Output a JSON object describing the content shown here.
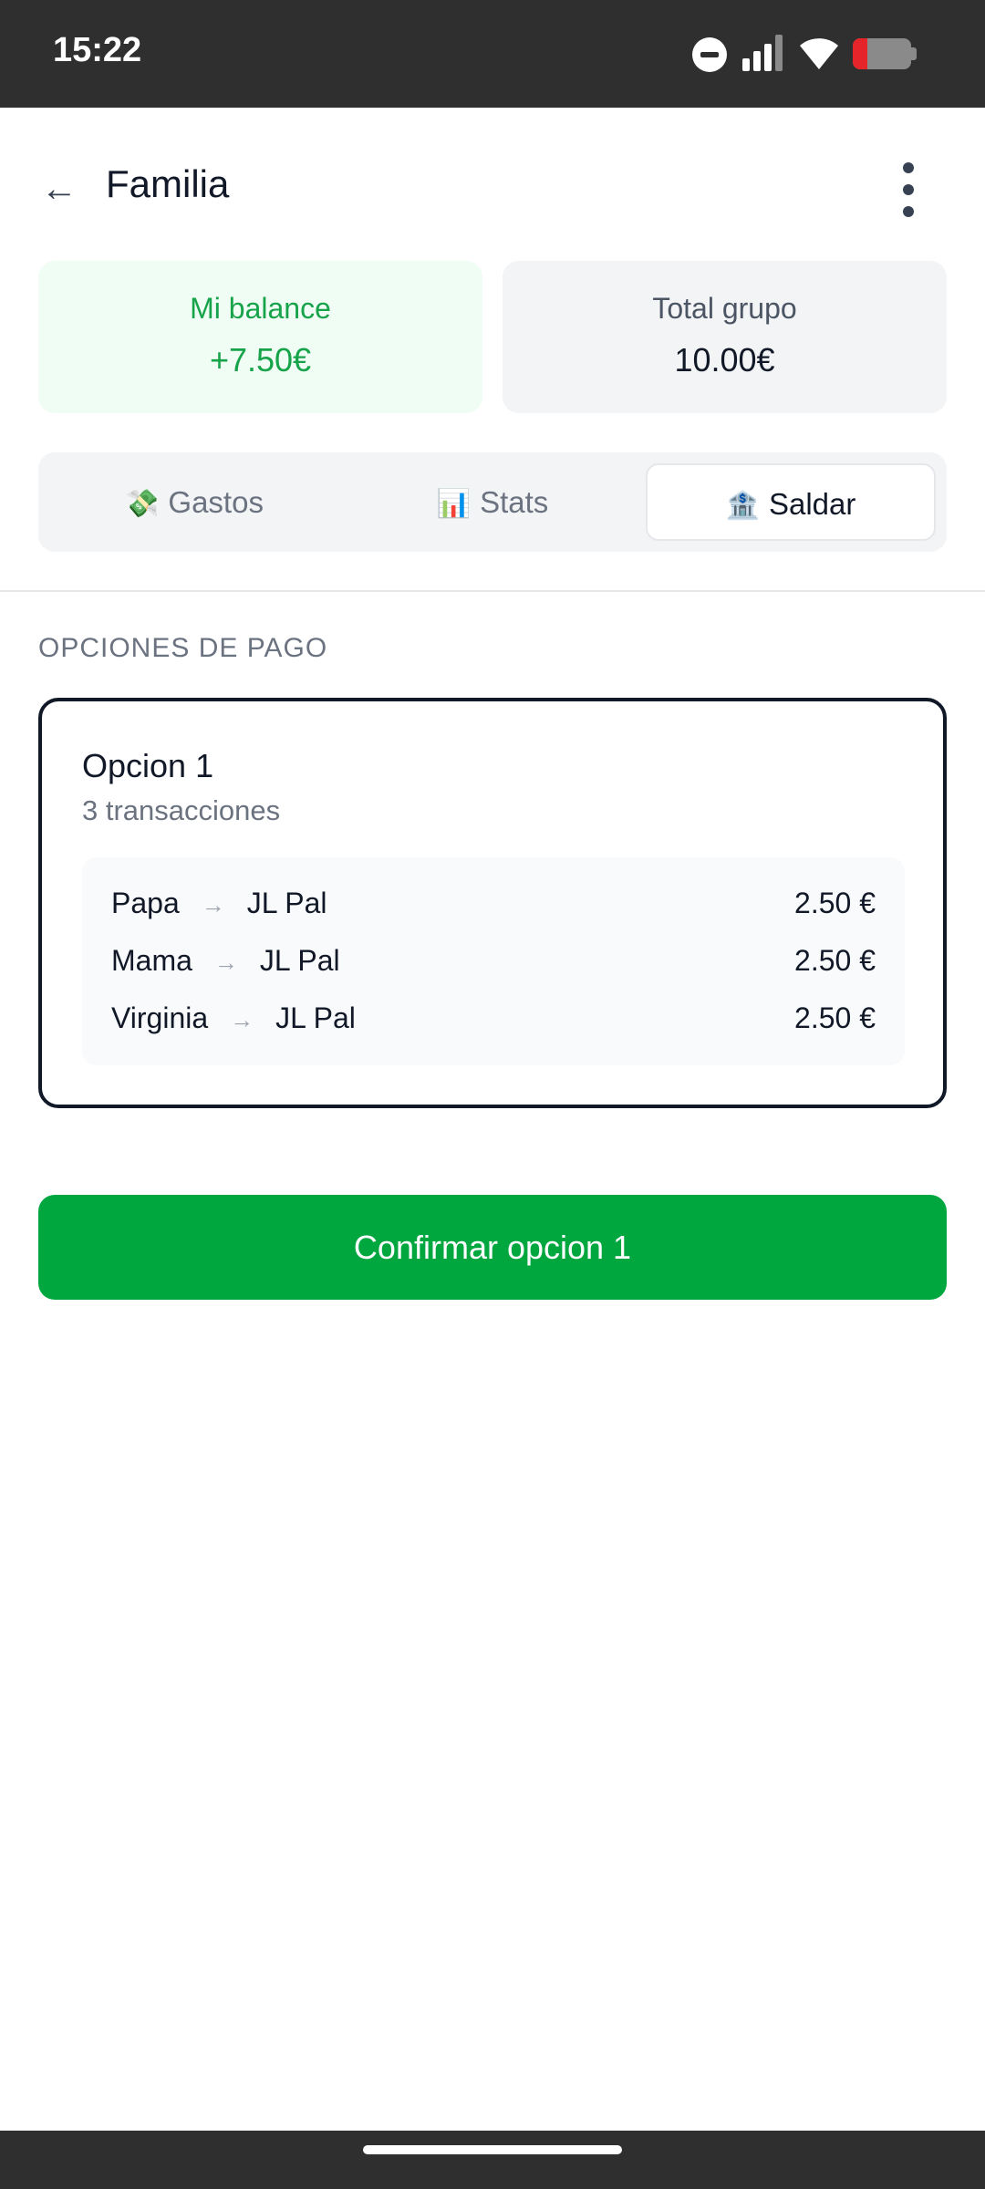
{
  "status_bar": {
    "time": "15:22",
    "icons": [
      "do-not-disturb-icon",
      "signal-icon",
      "wifi-icon",
      "battery-icon"
    ],
    "battery_level": 0.25,
    "battery_color": "#e5252a"
  },
  "header": {
    "back_icon": "←",
    "title": "Familia",
    "menu_icon": "more-vertical-icon"
  },
  "summary": {
    "balance_label": "Mi balance",
    "balance_value": "+7.50€",
    "total_label": "Total grupo",
    "total_value": "10.00€",
    "balance_color": "#16a34a"
  },
  "tabs": [
    {
      "emoji": "💸",
      "label": "Gastos",
      "active": false
    },
    {
      "emoji": "📊",
      "label": "Stats",
      "active": false
    },
    {
      "emoji": "🏦",
      "label": "Saldar",
      "active": true
    }
  ],
  "section": {
    "title": "OPCIONES DE PAGO"
  },
  "option": {
    "title": "Opcion 1",
    "subtitle": "3 transacciones",
    "transactions": [
      {
        "from": "Papa",
        "arrow": "→",
        "to": "JL Pal",
        "amount": "2.50 €"
      },
      {
        "from": "Mama",
        "arrow": "→",
        "to": "JL Pal",
        "amount": "2.50 €"
      },
      {
        "from": "Virginia",
        "arrow": "→",
        "to": "JL Pal",
        "amount": "2.50 €"
      }
    ]
  },
  "confirm_button": {
    "label": "Confirmar opcion 1",
    "color": "#00a63e"
  }
}
